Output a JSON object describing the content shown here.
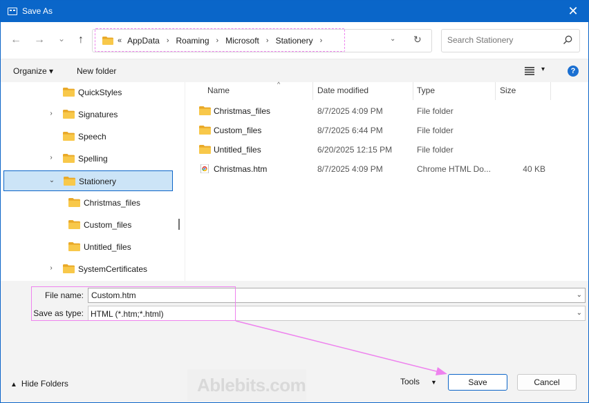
{
  "window": {
    "title": "Save As",
    "close_glyph": "✕"
  },
  "nav": {
    "back_glyph": "←",
    "forward_glyph": "→",
    "recent_glyph": "⌄",
    "up_glyph": "↑",
    "address": {
      "overflow": "«",
      "crumbs": [
        "AppData",
        "Roaming",
        "Microsoft",
        "Stationery"
      ],
      "separator": "›",
      "dropdown_glyph": "⌄",
      "refresh_glyph": "↻"
    },
    "search_placeholder": "Search Stationery"
  },
  "commandbar": {
    "organize": "Organize ▾",
    "new_folder": "New folder",
    "view_caret": "▾",
    "help": "?"
  },
  "tree": {
    "items": [
      {
        "label": "QuickStyles",
        "chevron": "",
        "indent": 0
      },
      {
        "label": "Signatures",
        "chevron": "›",
        "indent": 0
      },
      {
        "label": "Speech",
        "chevron": "",
        "indent": 0
      },
      {
        "label": "Spelling",
        "chevron": "›",
        "indent": 0
      },
      {
        "label": "Stationery",
        "chevron": "⌄",
        "indent": 0,
        "selected": true
      },
      {
        "label": "Christmas_files",
        "chevron": "",
        "indent": 1
      },
      {
        "label": "Custom_files",
        "chevron": "",
        "indent": 1
      },
      {
        "label": "Untitled_files",
        "chevron": "",
        "indent": 1
      },
      {
        "label": "SystemCertificates",
        "chevron": "›",
        "indent": 0
      }
    ]
  },
  "files": {
    "columns": {
      "name": "Name",
      "date": "Date modified",
      "type": "Type",
      "size": "Size",
      "sort_caret": "^"
    },
    "rows": [
      {
        "name": "Christmas_files",
        "date": "8/7/2025 4:09 PM",
        "type": "File folder",
        "size": "",
        "icon": "folder-icon"
      },
      {
        "name": "Custom_files",
        "date": "8/7/2025 6:44 PM",
        "type": "File folder",
        "size": "",
        "icon": "folder-icon"
      },
      {
        "name": "Untitled_files",
        "date": "6/20/2025 12:15 PM",
        "type": "File folder",
        "size": "",
        "icon": "folder-icon"
      },
      {
        "name": "Christmas.htm",
        "date": "8/7/2025 4:09 PM",
        "type": "Chrome HTML Do...",
        "size": "40 KB",
        "icon": "chrome-html-icon"
      }
    ]
  },
  "fields": {
    "file_name_label": "File name:",
    "file_name_value": "Custom.htm",
    "save_type_label": "Save as type:",
    "save_type_value": "HTML (*.htm;*.html)",
    "dropdown_glyph": "⌄"
  },
  "footer": {
    "hide_folders_caret": "▲",
    "hide_folders": "Hide Folders",
    "watermark": "Ablebits.com",
    "tools": "Tools",
    "tools_caret": "▼",
    "save": "Save",
    "cancel": "Cancel"
  },
  "colors": {
    "titlebar": "#0a66c9",
    "folder": "#f8c84a",
    "annotation": "#ee82ee",
    "selection": "#cce4f7"
  }
}
